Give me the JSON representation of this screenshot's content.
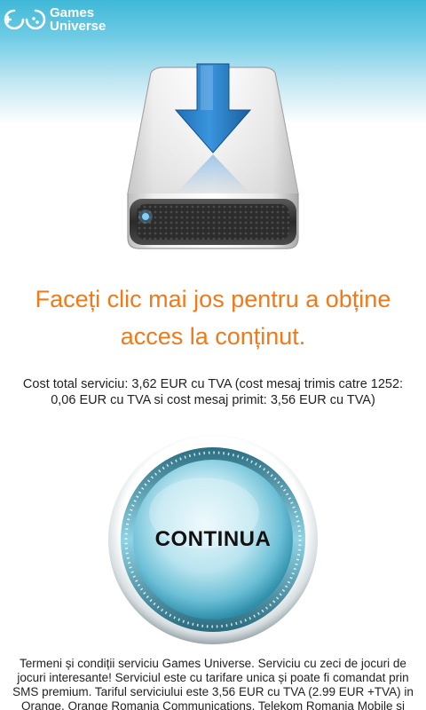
{
  "header": {
    "logo_icon": "gamepad-icon",
    "logo_line1": "Games",
    "logo_line2": "Universe"
  },
  "hero": {
    "icon": "download-drive-icon"
  },
  "headline": "Faceți clic mai jos pentru a obține acces la conținut.",
  "cost_text": "Cost total serviciu: 3,62 EUR cu TVA (cost mesaj trimis catre 1252: 0,06 EUR cu TVA si cost mesaj primit: 3,56 EUR cu TVA)",
  "continue_button": {
    "label": "CONTINUA"
  },
  "terms_text": "Termeni și condiții serviciu Games Universe. Serviciu cu zeci de jocuri de jocuri interesante! Serviciul este cu tarifare unica și poate fi comandat prin SMS premium. Tariful serviciului este 3,56 EUR cu TVA (2.99 EUR +TVA) in Orange, Orange Romania Communications, Telekom Romania Mobile si",
  "colors": {
    "header_blue": "#3fb8d8",
    "headline_orange": "#f07a1a",
    "button_teal": "#5fb8d0"
  }
}
